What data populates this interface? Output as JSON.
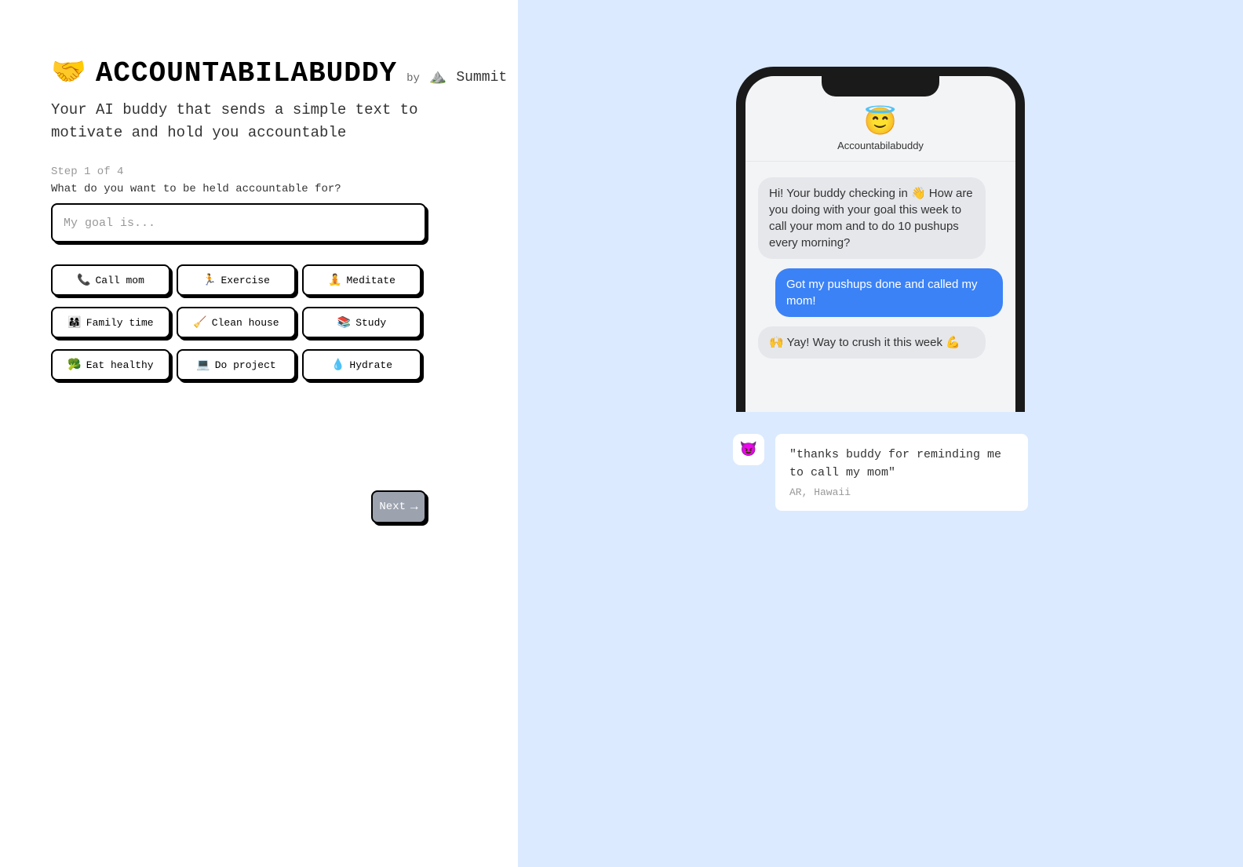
{
  "header": {
    "logo_emoji": "🤝",
    "logo_text": "ACCOUNTABILABUDDY",
    "by_label": "by",
    "summit_emoji": "⛰️",
    "summit_text": "Summit"
  },
  "tagline": "Your AI buddy that sends a simple text to motivate and hold you accountable",
  "step_label": "Step 1 of 4",
  "question": "What do you want to be held accountable for?",
  "input_placeholder": "My goal is...",
  "goals": [
    {
      "icon": "📞",
      "label": "Call mom"
    },
    {
      "icon": "🏃",
      "label": "Exercise"
    },
    {
      "icon": "🧘",
      "label": "Meditate"
    },
    {
      "icon": "👨‍👩‍👧",
      "label": "Family time"
    },
    {
      "icon": "🧹",
      "label": "Clean house"
    },
    {
      "icon": "📚",
      "label": "Study"
    },
    {
      "icon": "🥦",
      "label": "Eat healthy"
    },
    {
      "icon": "💻",
      "label": "Do project"
    },
    {
      "icon": "💧",
      "label": "Hydrate"
    }
  ],
  "next_label": "Next",
  "phone": {
    "buddy_emoji": "😇",
    "buddy_name": "Accountabilabuddy",
    "messages": [
      {
        "type": "received",
        "text": "Hi! Your buddy checking in 👋 How are you doing with your goal this week to call your mom and to do 10 pushups every morning?"
      },
      {
        "type": "sent",
        "text": "Got my pushups done and called my mom!"
      },
      {
        "type": "received",
        "text": "🙌 Yay!  Way to crush it this week 💪"
      }
    ]
  },
  "testimonial": {
    "avatar_emoji": "😈",
    "quote": "\"thanks buddy for reminding me to call my mom\"",
    "author": "AR, Hawaii"
  }
}
